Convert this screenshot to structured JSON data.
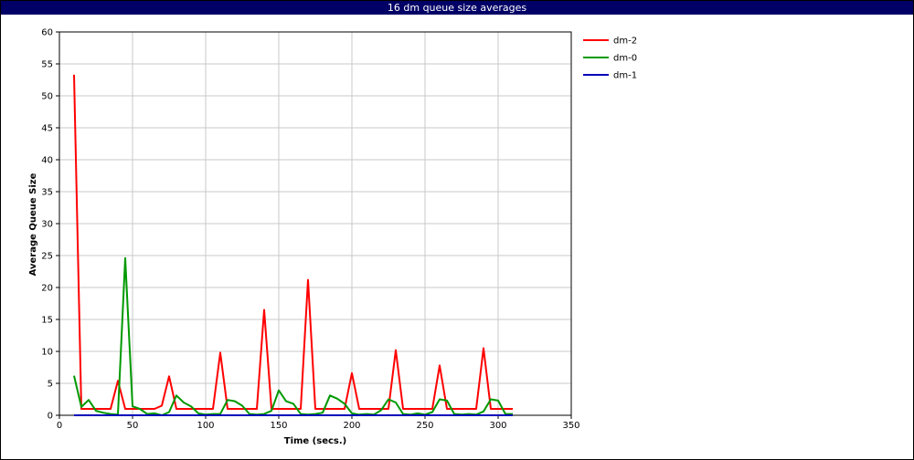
{
  "window": {
    "title": "16 dm queue size averages"
  },
  "chart_data": {
    "type": "line",
    "title": "16 dm queue size averages",
    "xlabel": "Time (secs.)",
    "ylabel": "Average Queue Size",
    "xlim": [
      0,
      350
    ],
    "ylim": [
      0,
      60
    ],
    "xticks": [
      0,
      50,
      100,
      150,
      200,
      250,
      300,
      350
    ],
    "yticks": [
      0,
      5,
      10,
      15,
      20,
      25,
      30,
      35,
      40,
      45,
      50,
      55,
      60
    ],
    "grid": true,
    "legend_position": "top-right",
    "series": [
      {
        "name": "dm-2",
        "color": "#ff0000",
        "x": [
          10,
          15,
          20,
          25,
          30,
          35,
          40,
          45,
          50,
          55,
          60,
          65,
          70,
          75,
          80,
          85,
          90,
          95,
          100,
          105,
          110,
          115,
          120,
          125,
          130,
          135,
          140,
          145,
          150,
          155,
          160,
          165,
          170,
          175,
          180,
          185,
          190,
          195,
          200,
          205,
          210,
          215,
          220,
          225,
          230,
          235,
          240,
          245,
          250,
          255,
          260,
          265,
          270,
          275,
          280,
          285,
          290,
          295,
          300,
          305,
          310
        ],
        "y": [
          53.3,
          1.0,
          1.0,
          1.0,
          1.0,
          1.0,
          5.4,
          1.0,
          1.0,
          1.0,
          1.0,
          1.0,
          1.5,
          6.1,
          1.0,
          1.0,
          1.0,
          1.0,
          1.0,
          1.0,
          9.8,
          1.0,
          1.0,
          1.0,
          1.0,
          1.0,
          16.5,
          1.0,
          1.0,
          1.0,
          1.0,
          1.0,
          21.2,
          1.0,
          1.0,
          1.0,
          1.0,
          1.0,
          6.6,
          1.0,
          1.0,
          1.0,
          1.0,
          1.0,
          10.2,
          1.0,
          1.0,
          1.0,
          1.0,
          1.0,
          7.8,
          1.0,
          1.0,
          1.0,
          1.0,
          1.0,
          10.5,
          1.0,
          1.0,
          1.0,
          1.0
        ]
      },
      {
        "name": "dm-0",
        "color": "#009900",
        "x": [
          10,
          15,
          20,
          25,
          30,
          35,
          40,
          45,
          50,
          55,
          60,
          65,
          70,
          75,
          80,
          85,
          90,
          95,
          100,
          105,
          110,
          115,
          120,
          125,
          130,
          135,
          140,
          145,
          150,
          155,
          160,
          165,
          170,
          175,
          180,
          185,
          190,
          195,
          200,
          205,
          210,
          215,
          220,
          225,
          230,
          235,
          240,
          245,
          250,
          255,
          260,
          265,
          270,
          275,
          280,
          285,
          290,
          295,
          300,
          305,
          310
        ],
        "y": [
          6.2,
          1.3,
          2.4,
          0.7,
          0.4,
          0.2,
          0.1,
          24.6,
          1.4,
          1.0,
          0.2,
          0.3,
          0.0,
          0.5,
          3.1,
          2.0,
          1.4,
          0.3,
          0.1,
          0.2,
          0.2,
          2.4,
          2.2,
          1.5,
          0.2,
          0.1,
          0.2,
          0.7,
          3.9,
          2.2,
          1.8,
          0.2,
          0.1,
          0.2,
          0.4,
          3.1,
          2.6,
          1.8,
          0.3,
          0.1,
          0.2,
          0.1,
          0.8,
          2.5,
          2.0,
          0.2,
          0.1,
          0.3,
          0.1,
          0.5,
          2.5,
          2.3,
          0.2,
          0.1,
          0.2,
          0.1,
          0.6,
          2.5,
          2.3,
          0.2,
          0.2
        ]
      },
      {
        "name": "dm-1",
        "color": "#0000bb",
        "x": [
          10,
          310
        ],
        "y": [
          0.0,
          0.0
        ]
      }
    ]
  }
}
